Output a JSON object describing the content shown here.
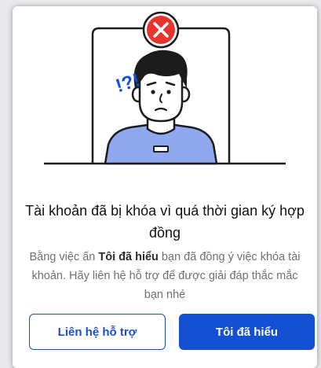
{
  "illustration": {
    "alert_text": "!?!",
    "icons": [
      "error-x-icon",
      "confused-person-illustration"
    ]
  },
  "dialog": {
    "title": "Tài khoản đã bị khóa vì quá thời gian ký hợp đồng",
    "description_prefix": "Bằng việc ấn ",
    "description_bold": "Tôi đã hiểu",
    "description_suffix": " bạn đã đồng ý việc khóa tài khoản. Hãy liên hệ hỗ trợ để được giải đáp thắc mắc bạn nhé"
  },
  "buttons": {
    "contact_support": "Liên hệ hỗ trợ",
    "understood": "Tôi đã hiểu"
  },
  "colors": {
    "primary": "#1450d2",
    "error_red": "#e8332e",
    "shirt_blue": "#90a8ee"
  }
}
